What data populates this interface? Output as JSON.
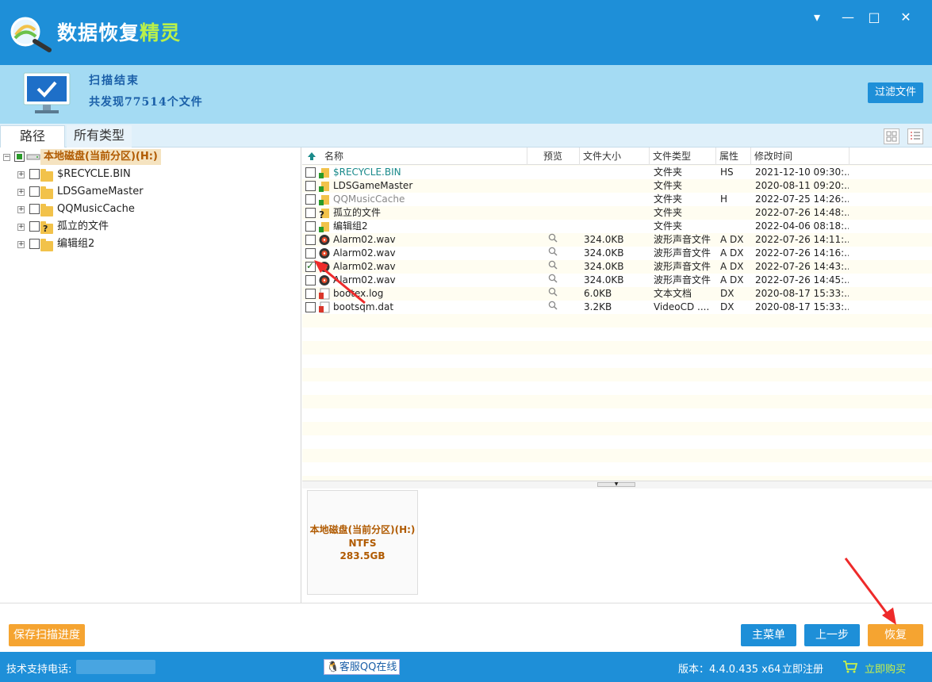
{
  "app": {
    "title_main": "数据恢复",
    "title_accent": "精灵",
    "window_controls": [
      "▾",
      "—",
      "□",
      "✕"
    ]
  },
  "status": {
    "title": "扫描结束",
    "count": "共发现77514个文件",
    "filter_button": "过滤文件"
  },
  "tabs": [
    {
      "label": "路径",
      "active": true
    },
    {
      "label": "所有类型",
      "active": false
    }
  ],
  "tree": {
    "root": "本地磁盘(当前分区)(H:)",
    "items": [
      {
        "label": "$RECYCLE.BIN",
        "icon": "folder-icon"
      },
      {
        "label": "LDSGameMaster",
        "icon": "folder-icon"
      },
      {
        "label": "QQMusicCache",
        "icon": "folder-icon"
      },
      {
        "label": "孤立的文件",
        "icon": "orphan-folder-icon"
      },
      {
        "label": "编辑组2",
        "icon": "folder-icon"
      }
    ]
  },
  "file_list": {
    "columns": [
      "名称",
      "预览",
      "文件大小",
      "文件类型",
      "属性",
      "修改时间"
    ],
    "rows": [
      {
        "name": "$RECYCLE.BIN",
        "preview": false,
        "size": "",
        "type": "文件夹",
        "attr": "HS",
        "mtime": "2021-12-10 09:30:...",
        "checked": false,
        "kind": "folder",
        "color": "#1a8a8a"
      },
      {
        "name": "LDSGameMaster",
        "preview": false,
        "size": "",
        "type": "文件夹",
        "attr": "",
        "mtime": "2020-08-11 09:20:...",
        "checked": false,
        "kind": "folder",
        "color": "#222222"
      },
      {
        "name": "QQMusicCache",
        "preview": false,
        "size": "",
        "type": "文件夹",
        "attr": "H",
        "mtime": "2022-07-25 14:26:...",
        "checked": false,
        "kind": "folder",
        "color": "#888888"
      },
      {
        "name": "孤立的文件",
        "preview": false,
        "size": "",
        "type": "文件夹",
        "attr": "",
        "mtime": "2022-07-26 14:48:...",
        "checked": false,
        "kind": "orphan",
        "color": "#222222"
      },
      {
        "name": "编辑组2",
        "preview": false,
        "size": "",
        "type": "文件夹",
        "attr": "",
        "mtime": "2022-04-06 08:18:...",
        "checked": false,
        "kind": "folder",
        "color": "#222222"
      },
      {
        "name": "Alarm02.wav",
        "preview": true,
        "size": "324.0KB",
        "type": "波形声音文件",
        "attr": "A DX",
        "mtime": "2022-07-26 14:11:...",
        "checked": false,
        "kind": "audio",
        "color": "#222222"
      },
      {
        "name": "Alarm02.wav",
        "preview": true,
        "size": "324.0KB",
        "type": "波形声音文件",
        "attr": "A DX",
        "mtime": "2022-07-26 14:16:...",
        "checked": false,
        "kind": "audio",
        "color": "#222222"
      },
      {
        "name": "Alarm02.wav",
        "preview": true,
        "size": "324.0KB",
        "type": "波形声音文件",
        "attr": "A DX",
        "mtime": "2022-07-26 14:43:...",
        "checked": true,
        "kind": "audio",
        "color": "#222222"
      },
      {
        "name": "Alarm02.wav",
        "preview": true,
        "size": "324.0KB",
        "type": "波形声音文件",
        "attr": "A DX",
        "mtime": "2022-07-26 14:45:...",
        "checked": false,
        "kind": "audio",
        "color": "#222222"
      },
      {
        "name": "bootex.log",
        "preview": true,
        "size": "6.0KB",
        "type": "文本文档",
        "attr": "DX",
        "mtime": "2020-08-17 15:33:...",
        "checked": false,
        "kind": "doc",
        "color": "#222222"
      },
      {
        "name": "bootsqm.dat",
        "preview": true,
        "size": "3.2KB",
        "type": "VideoCD ....",
        "attr": "DX",
        "mtime": "2020-08-17 15:33:...",
        "checked": false,
        "kind": "doc",
        "color": "#222222"
      }
    ]
  },
  "disk_card": {
    "name": "本地磁盘(当前分区)(H:)",
    "fs": "NTFS",
    "size": "283.5GB"
  },
  "actions": {
    "save_progress": "保存扫描进度",
    "main_menu": "主菜单",
    "prev_step": "上一步",
    "recover": "恢复"
  },
  "footer": {
    "support": "技术支持电话:",
    "qq": "客服QQ在线",
    "version": "版本：4.4.0.435 x64",
    "register": "立即注册",
    "buy": "立即购买"
  },
  "colors": {
    "brand_blue": "#1e8fd8",
    "accent_orange": "#f5a431",
    "status_band": "#a4dbf3"
  }
}
